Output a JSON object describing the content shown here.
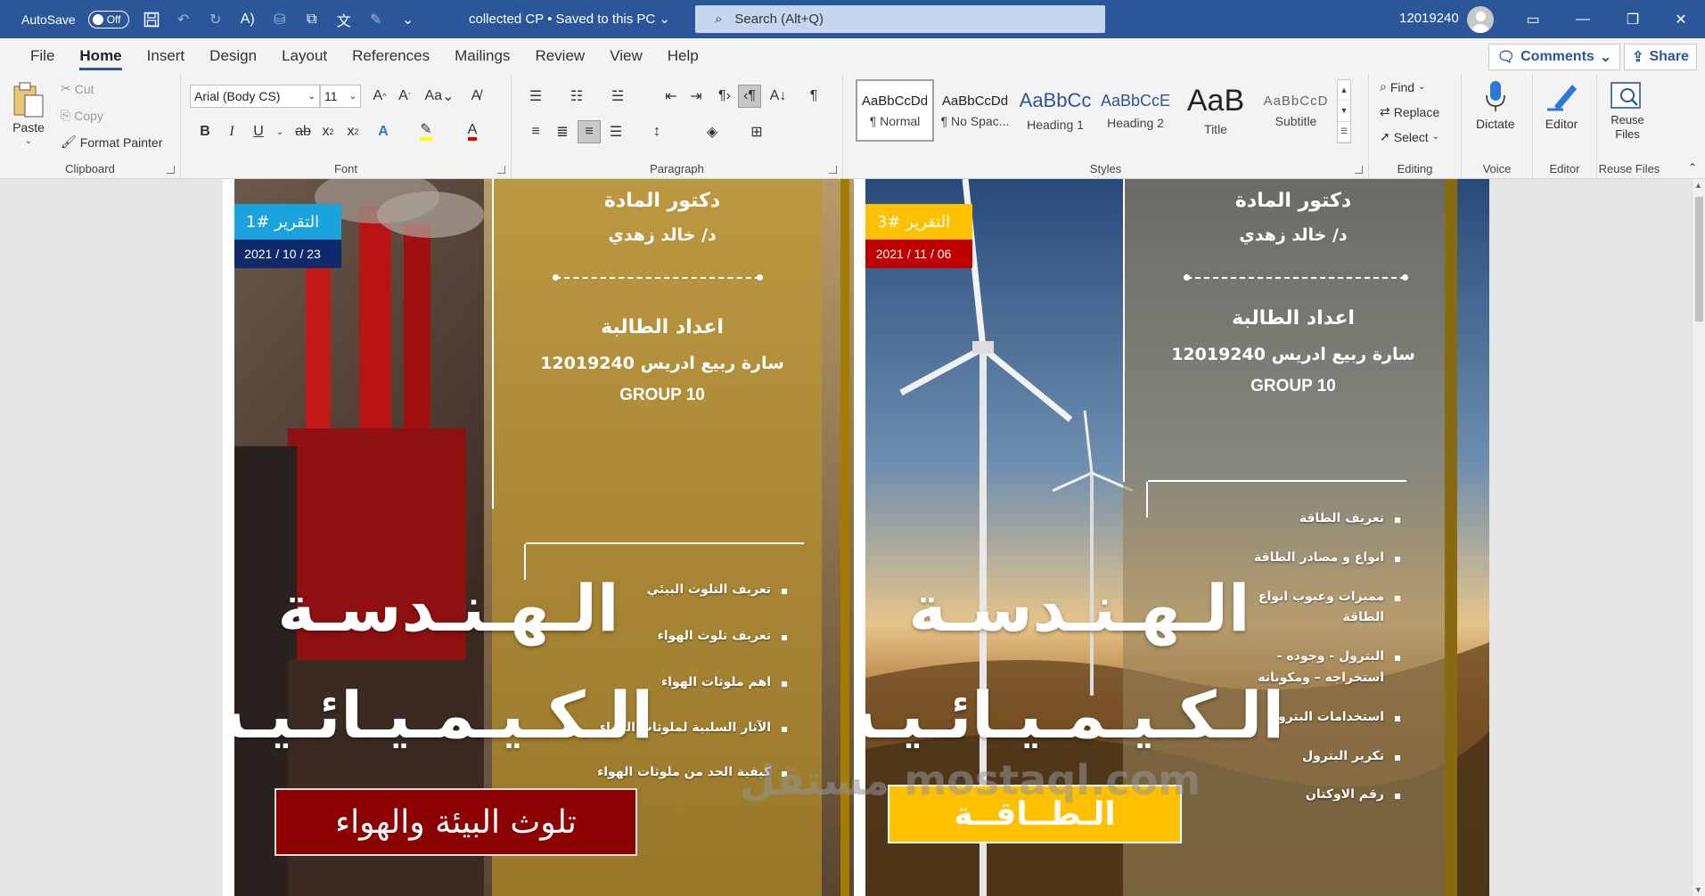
{
  "titlebar": {
    "autosave_label": "AutoSave",
    "autosave_state": "Off",
    "document_title": "collected CP • Saved to this PC",
    "search_placeholder": "Search (Alt+Q)",
    "user_id": "12019240"
  },
  "menu": {
    "tabs": [
      "File",
      "Home",
      "Insert",
      "Design",
      "Layout",
      "References",
      "Mailings",
      "Review",
      "View",
      "Help"
    ],
    "active_tab": "Home",
    "comments_label": "Comments",
    "share_label": "Share"
  },
  "ribbon": {
    "clipboard": {
      "paste": "Paste",
      "cut": "Cut",
      "copy": "Copy",
      "format_painter": "Format Painter",
      "label": "Clipboard"
    },
    "font": {
      "family": "Arial (Body CS)",
      "size": "11",
      "change_case": "Aa",
      "label": "Font"
    },
    "paragraph": {
      "label": "Paragraph"
    },
    "styles": {
      "items": [
        {
          "preview": "AaBbCcDd",
          "name": "¶ Normal"
        },
        {
          "preview": "AaBbCcDd",
          "name": "¶ No Spac..."
        },
        {
          "preview": "AaBbCc",
          "name": "Heading 1"
        },
        {
          "preview": "AaBbCcE",
          "name": "Heading 2"
        },
        {
          "preview": "AaB",
          "name": "Title"
        },
        {
          "preview": "AaBbCcD",
          "name": "Subtitle"
        }
      ],
      "label": "Styles"
    },
    "editing": {
      "find": "Find",
      "replace": "Replace",
      "select": "Select",
      "label": "Editing"
    },
    "voice": {
      "dictate": "Dictate",
      "label": "Voice"
    },
    "editor": {
      "editor": "Editor",
      "label": "Editor"
    },
    "reuse": {
      "reuse_files": "Reuse Files",
      "label": "Reuse Files"
    }
  },
  "colors": {
    "word_blue": "#2b579a",
    "report1_tag": "#1aa3dc",
    "report1_date": "#0f2a6b",
    "report1_topic_bg": "#8b0000",
    "report2_tag": "#ffc000",
    "report2_date": "#c00000",
    "report2_topic_bg": "#ffc000"
  },
  "pages": [
    {
      "tag": "التقرير #1",
      "date": "2021 /  10 / 23",
      "doctor_heading": "دكتور المادة",
      "doctor_name": "د/ خالد زهدي",
      "prepared_heading": "اعداد الطالبة",
      "student": "سارة ربيع ادريس   12019240",
      "group": "GROUP 10",
      "title_line1": "الـهـنـدسـة",
      "title_line2": "الـكـيـمـيـائـيـة",
      "topic": "تلوث البيئة والهواء",
      "toc": [
        "تعريف التلوث البيئي",
        "تعريف تلوث الهواء",
        "اهم ملوثات الهواء",
        "الآثار السلبية لملوثات الهواء",
        "كيفية الحد من ملوثات الهواء"
      ]
    },
    {
      "tag": "التقرير #3",
      "date": "2021 /  11 / 06",
      "doctor_heading": "دكتور المادة",
      "doctor_name": "د/ خالد زهدي",
      "prepared_heading": "اعداد الطالبة",
      "student": "سارة ربيع ادريس   12019240",
      "group": "GROUP 10",
      "title_line1": "الـهـنـدسـة",
      "title_line2": "الـكـيـمـيـائـيـة",
      "topic": "الـطــاقــة",
      "toc": [
        "تعريف الطاقة",
        "انواع و مصادر الطاقة",
        "مميزات وعيوب انواع الطاقة",
        "البترول - وجوده - استخراجه – ومكوناته",
        "استخدامات البترول",
        "تكرير البترول",
        "رقم الاوكتان"
      ]
    }
  ],
  "watermark": "مستقل mostaql.com"
}
